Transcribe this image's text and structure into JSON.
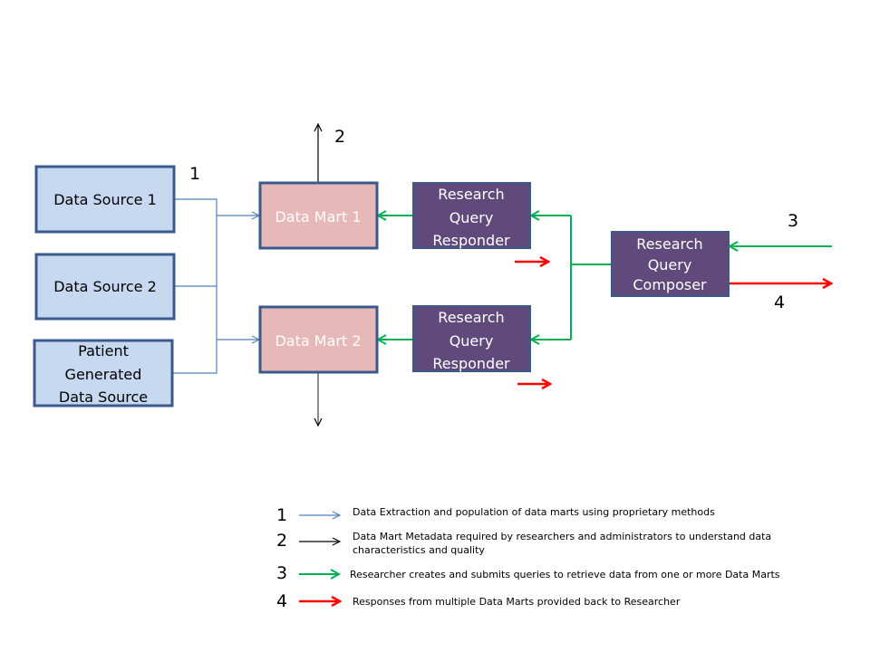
{
  "colors": {
    "source_fill": "#c6d9f1",
    "border": "#3a5a8c",
    "mart_fill": "#e6b8b7",
    "composer_fill": "#5f4a7b",
    "flow_blue": "#4f81bd",
    "flow_black": "#000000",
    "flow_green": "#00b050",
    "flow_red": "#ff0000"
  },
  "nodes": {
    "data_source_1": "Data Source 1",
    "data_source_2": "Data Source 2",
    "patient_source": [
      "Patient",
      "Generated",
      "Data Source"
    ],
    "data_mart_1": "Data Mart 1",
    "data_mart_2": "Data Mart 2",
    "responder_1": [
      "Research",
      "Query",
      "Responder"
    ],
    "responder_2": [
      "Research",
      "Query",
      "Responder"
    ],
    "composer": [
      "Research",
      "Query",
      "Composer"
    ]
  },
  "flow_labels": {
    "one": "1",
    "two": "2",
    "three": "3",
    "four": "4"
  },
  "legend": [
    {
      "num": "1",
      "color": "blue",
      "lines": [
        "Data Extraction and population of data marts using proprietary methods"
      ]
    },
    {
      "num": "2",
      "color": "black",
      "lines": [
        "Data Mart Metadata required by researchers  and administrators to understand data",
        "characteristics and quality"
      ]
    },
    {
      "num": "3",
      "color": "green",
      "lines": [
        "Researcher creates and submits queries to retrieve data from one or more Data Marts"
      ]
    },
    {
      "num": "4",
      "color": "red",
      "lines": [
        "Responses from multiple  Data Marts provided back to Researcher"
      ]
    }
  ]
}
